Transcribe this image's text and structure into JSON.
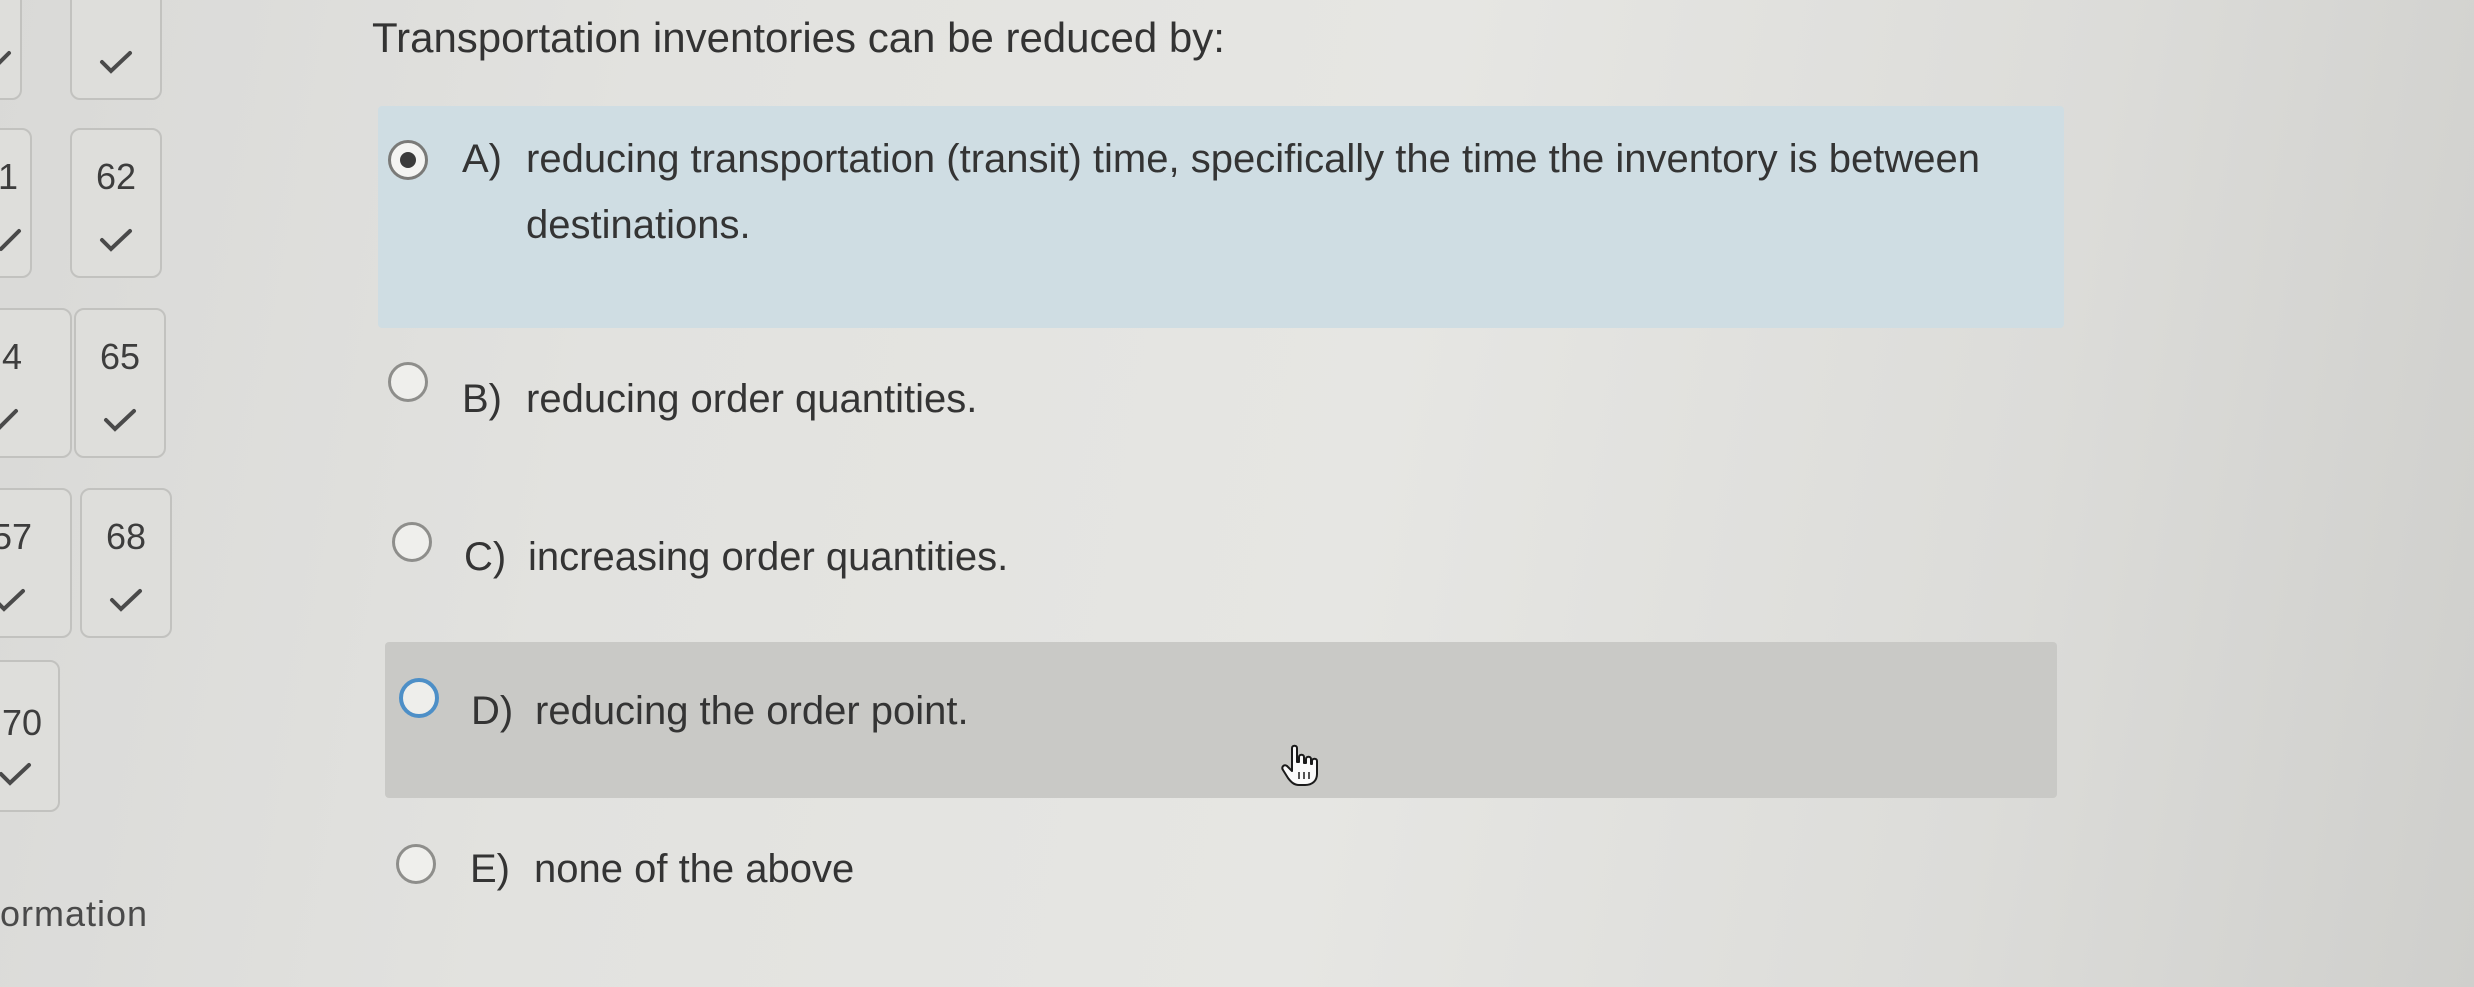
{
  "navigator": {
    "tiles": [
      {
        "number": "",
        "status": "correct"
      },
      {
        "number": "1",
        "status": "correct"
      },
      {
        "number": "62",
        "status": "correct"
      },
      {
        "number": "4",
        "status": "correct"
      },
      {
        "number": "65",
        "status": "correct"
      },
      {
        "number": "57",
        "status": "correct"
      },
      {
        "number": "68",
        "status": "correct"
      },
      {
        "number": "70",
        "status": "correct"
      }
    ],
    "section_label": "ormation"
  },
  "question": {
    "text": "Transportation inventories can be reduced by:",
    "selected": "A",
    "choices": [
      {
        "letter": "A)",
        "text": "reducing transportation (transit) time, specifically the time the inventory is between destinations."
      },
      {
        "letter": "B)",
        "text": "reducing order quantities."
      },
      {
        "letter": "C)",
        "text": "increasing order quantities."
      },
      {
        "letter": "D)",
        "text": "reducing the order point."
      },
      {
        "letter": "E)",
        "text": "none of the above"
      }
    ]
  },
  "colors": {
    "selected_bg": "#cfdde3",
    "hover_bg": "#c9c9c6",
    "focus_ring": "#4d8fc7",
    "check": "#4a4a4a"
  },
  "icons": {
    "check": "check-icon",
    "cursor": "hand-pointer-cursor-icon"
  }
}
